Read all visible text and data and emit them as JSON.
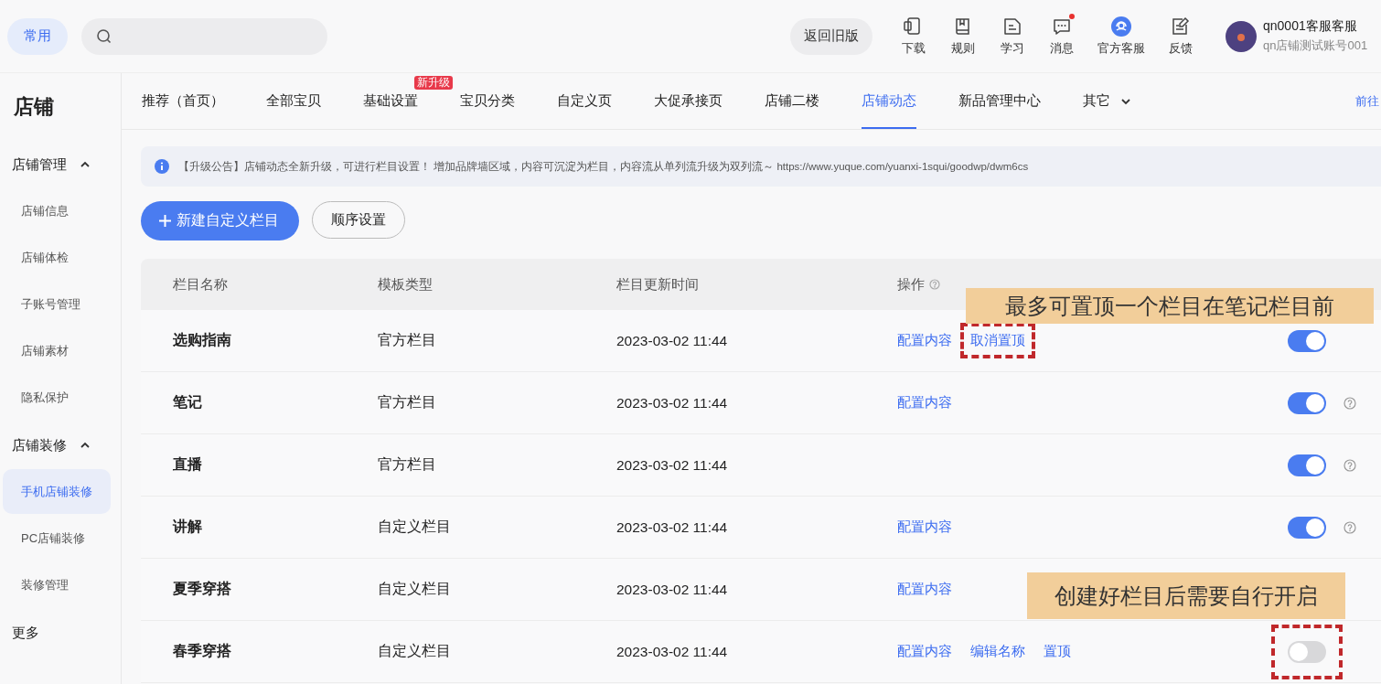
{
  "topbar": {
    "common_button": "常用",
    "back_button": "返回旧版",
    "tools": [
      {
        "label": "下载",
        "badge": false
      },
      {
        "label": "规则",
        "badge": false
      },
      {
        "label": "学习",
        "badge": false
      },
      {
        "label": "消息",
        "badge": true
      },
      {
        "label": "官方客服",
        "badge": false
      },
      {
        "label": "反馈",
        "badge": false
      }
    ],
    "user": {
      "name": "qn0001客服客服",
      "account": "qn店铺测试账号001"
    }
  },
  "sidebar": {
    "title": "店铺",
    "groups": [
      {
        "label": "店铺管理",
        "expanded": true,
        "children": [
          {
            "label": "店铺信息",
            "selected": false
          },
          {
            "label": "店铺体检",
            "selected": false
          },
          {
            "label": "子账号管理",
            "selected": false
          },
          {
            "label": "店铺素材",
            "selected": false
          },
          {
            "label": "隐私保护",
            "selected": false
          }
        ]
      },
      {
        "label": "店铺装修",
        "expanded": true,
        "children": [
          {
            "label": "手机店铺装修",
            "selected": true
          },
          {
            "label": "PC店铺装修",
            "selected": false
          },
          {
            "label": "装修管理",
            "selected": false
          }
        ]
      }
    ],
    "more": "更多"
  },
  "tabs": [
    {
      "label": "推荐（首页）",
      "selected": false
    },
    {
      "label": "全部宝贝",
      "selected": false
    },
    {
      "label": "基础设置",
      "selected": false,
      "badge": "新升级"
    },
    {
      "label": "宝贝分类",
      "selected": false
    },
    {
      "label": "自定义页",
      "selected": false
    },
    {
      "label": "大促承接页",
      "selected": false
    },
    {
      "label": "店铺二楼",
      "selected": false
    },
    {
      "label": "店铺动态",
      "selected": true
    },
    {
      "label": "新品管理中心",
      "selected": false
    },
    {
      "label": "其它",
      "selected": false,
      "dropdown": true
    }
  ],
  "tabs_link": "前往",
  "notice": "【升级公告】店铺动态全新升级，可进行栏目设置！ 增加品牌墙区域，内容可沉淀为栏目，内容流从单列流升级为双列流～ https://www.yuque.com/yuanxi-1squi/goodwp/dwm6cs",
  "actions": {
    "primary": "新建自定义栏目",
    "secondary": "顺序设置"
  },
  "table": {
    "columns": [
      "栏目名称",
      "模板类型",
      "栏目更新时间",
      "操作"
    ],
    "rows": [
      {
        "name": "选购指南",
        "type": "官方栏目",
        "updated": "2023-03-02 11:44",
        "actions": [
          {
            "label": "配置内容",
            "highlighted": false
          },
          {
            "label": "取消置顶",
            "highlighted": true
          }
        ],
        "on": true,
        "switch_highlighted": false,
        "help": false
      },
      {
        "name": "笔记",
        "type": "官方栏目",
        "updated": "2023-03-02 11:44",
        "actions": [
          {
            "label": "配置内容",
            "highlighted": false
          }
        ],
        "on": true,
        "switch_highlighted": false,
        "help": true
      },
      {
        "name": "直播",
        "type": "官方栏目",
        "updated": "2023-03-02 11:44",
        "actions": [],
        "on": true,
        "switch_highlighted": false,
        "help": true
      },
      {
        "name": "讲解",
        "type": "自定义栏目",
        "updated": "2023-03-02 11:44",
        "actions": [
          {
            "label": "配置内容",
            "highlighted": false
          }
        ],
        "on": true,
        "switch_highlighted": false,
        "help": true
      },
      {
        "name": "夏季穿搭",
        "type": "自定义栏目",
        "updated": "2023-03-02 11:44",
        "actions": [
          {
            "label": "配置内容",
            "highlighted": false
          }
        ],
        "help": false
      },
      {
        "name": "春季穿搭",
        "type": "自定义栏目",
        "updated": "2023-03-02 11:44",
        "actions": [
          {
            "label": "配置内容",
            "highlighted": false
          },
          {
            "label": "编辑名称",
            "highlighted": false
          },
          {
            "label": "置顶",
            "highlighted": false
          }
        ],
        "on": false,
        "switch_highlighted": true,
        "help": false
      }
    ]
  },
  "callouts": [
    "最多可置顶一个栏目在笔记栏目前",
    "创建好栏目后需要自行开启"
  ]
}
